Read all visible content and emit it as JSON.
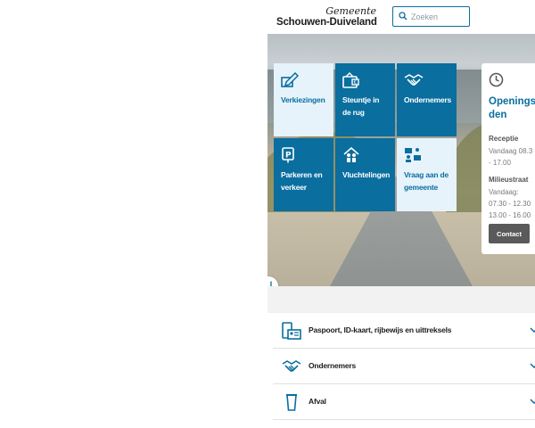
{
  "header": {
    "logo_line1": "Gemeente",
    "logo_line2": "Schouwen-Duiveland",
    "search_placeholder": "Zoeken"
  },
  "tiles": [
    {
      "label": "Verkiezingen",
      "icon": "ballot-pen-icon",
      "style": "light"
    },
    {
      "label": "Steuntje in de rug",
      "icon": "wallet-euro-icon",
      "style": "dark"
    },
    {
      "label": "Ondernemers",
      "icon": "handshake-icon",
      "style": "dark"
    },
    {
      "label": "Parkeren en verkeer",
      "icon": "parking-sign-icon",
      "style": "dark"
    },
    {
      "label": "Vluchtelingen",
      "icon": "family-house-icon",
      "style": "dark"
    },
    {
      "label": "Vraag aan de gemeente",
      "icon": "chat-person-icon",
      "style": "light"
    }
  ],
  "opening_hours": {
    "title": "Openingsti\nden",
    "reception_label": "Receptie",
    "reception_hours": "Vandaag 08.3\n- 17.00",
    "milieustraat_label": "Milieustraat",
    "milieustraat_hours": "Vandaag:\n07.30 - 12.30\n13.00 - 16.00",
    "contact_button": "Contact"
  },
  "accordion": [
    {
      "label": "Paspoort, ID-kaart, rijbewijs en uittreksels",
      "icon": "id-card-icon"
    },
    {
      "label": "Ondernemers",
      "icon": "handshake-icon"
    },
    {
      "label": "Afval",
      "icon": "waste-bin-icon"
    }
  ],
  "colors": {
    "primary": "#0a6e9f",
    "light_tile": "#e6f3fb",
    "button_dark": "#5a5a5a"
  }
}
